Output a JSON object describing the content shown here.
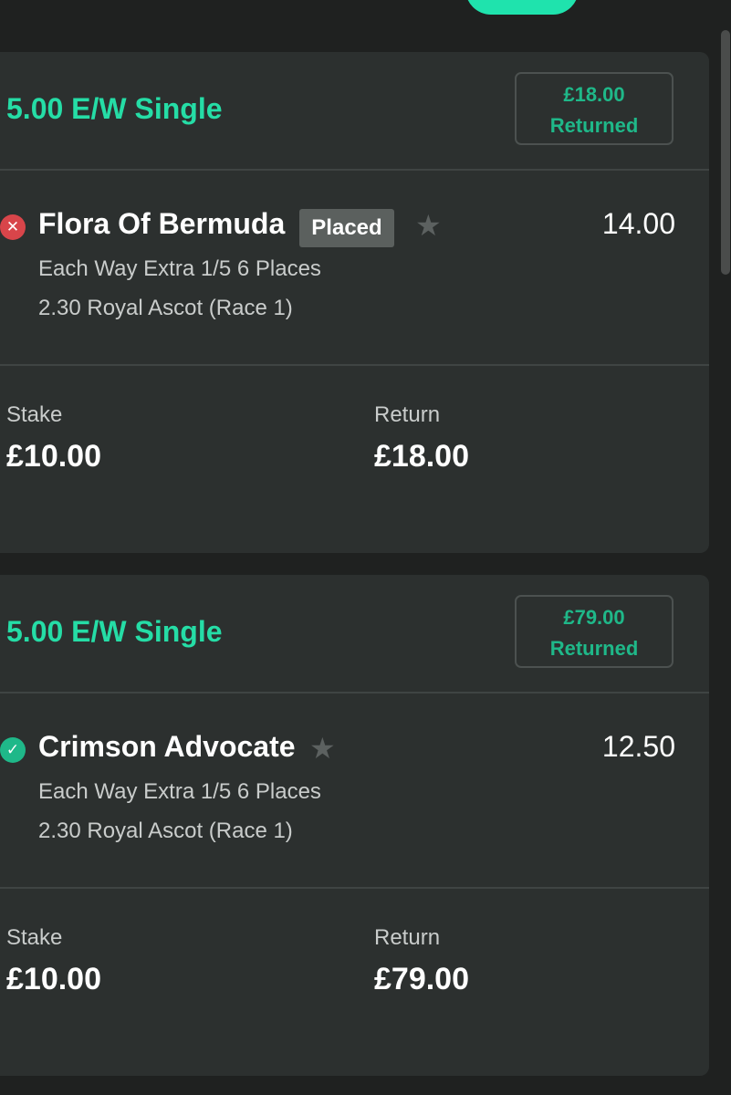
{
  "accent_color": "#25dda6",
  "bets": [
    {
      "bet_type": "5.00 E/W Single",
      "returned_amount": "£18.00",
      "returned_label": "Returned",
      "status_icon": "cross-icon",
      "runner": "Flora Of Bermuda",
      "badge": "Placed",
      "odds": "14.00",
      "market": "Each Way Extra 1/5 6 Places",
      "event": "2.30 Royal Ascot (Race 1)",
      "stake_label": "Stake",
      "stake": "£10.00",
      "return_label": "Return",
      "return": "£18.00"
    },
    {
      "bet_type": "5.00 E/W Single",
      "returned_amount": "£79.00",
      "returned_label": "Returned",
      "status_icon": "check-icon",
      "runner": "Crimson Advocate",
      "badge": "",
      "odds": "12.50",
      "market": "Each Way Extra 1/5 6 Places",
      "event": "2.30 Royal Ascot (Race 1)",
      "stake_label": "Stake",
      "stake": "£10.00",
      "return_label": "Return",
      "return": "£79.00"
    }
  ]
}
